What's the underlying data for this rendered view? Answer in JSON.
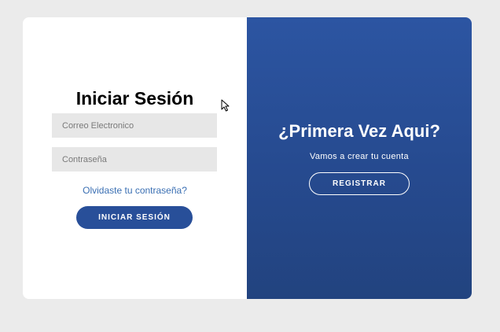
{
  "login": {
    "title": "Iniciar Sesión",
    "email_placeholder": "Correo Electronico",
    "password_placeholder": "Contraseña",
    "forgot_link": "Olvidaste tu contraseña?",
    "submit_label": "INICIAR SESIÓN"
  },
  "register": {
    "title": "¿Primera Vez Aqui?",
    "subtitle": "Vamos a crear tu cuenta",
    "button_label": "REGISTRAR"
  },
  "colors": {
    "accent": "#284f99",
    "panel_blue": "#2c55a2",
    "link": "#3a6fb3",
    "field_bg": "#e7e7e7",
    "page_bg": "#ebebeb"
  },
  "icons": {
    "cursor": "mouse-pointer-icon"
  }
}
